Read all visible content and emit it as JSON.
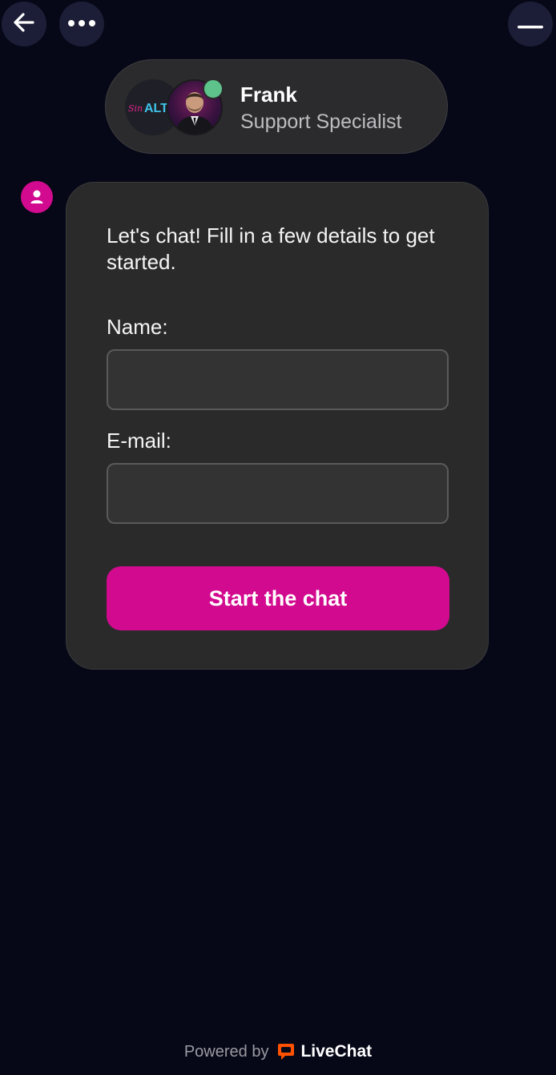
{
  "header": {
    "back_icon": "arrow-left-icon",
    "more_icon": "more-dots-icon",
    "minimize_icon": "minimize-icon"
  },
  "agent": {
    "name": "Frank",
    "role": "Support Specialist",
    "logo_text_script": "Sin",
    "logo_text_bold": "ALTO",
    "status": "online",
    "status_color": "#5dc38a"
  },
  "form": {
    "intro": "Let's chat! Fill in a few details to get started.",
    "name_label": "Name:",
    "name_value": "",
    "email_label": "E-mail:",
    "email_value": "",
    "submit_label": "Start the chat"
  },
  "footer": {
    "powered_by": "Powered by",
    "brand": "LiveChat",
    "brand_icon": "livechat-logo-icon"
  },
  "colors": {
    "background": "#060817",
    "accent": "#d20a8f",
    "card": "#2a2a2a",
    "livechat_orange": "#ff5100"
  }
}
